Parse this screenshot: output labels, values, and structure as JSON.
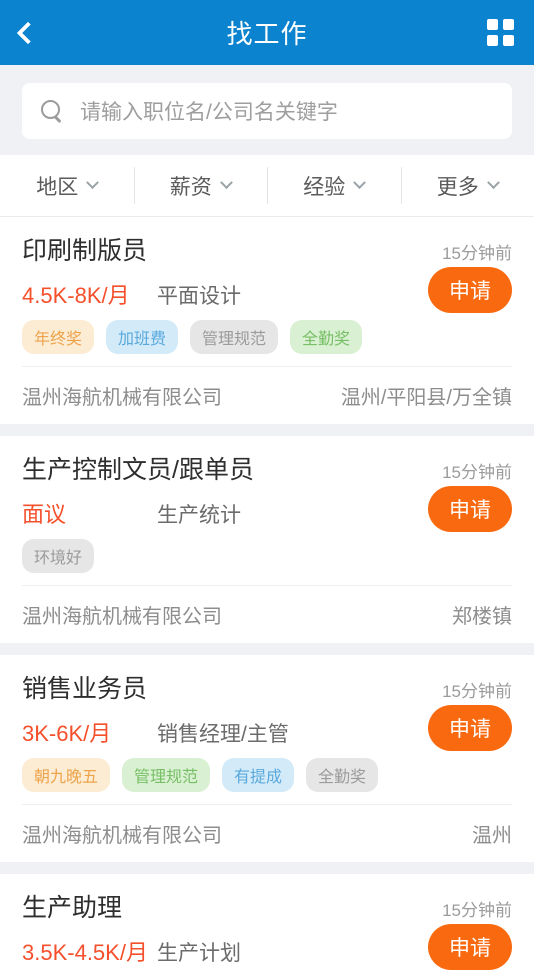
{
  "header": {
    "title": "找工作",
    "back_icon": "chevron-left-icon",
    "grid_icon": "grid-menu-icon",
    "bg_color": "#0b83cf"
  },
  "search": {
    "icon": "search-icon",
    "placeholder": "请输入职位名/公司名关键字",
    "value": ""
  },
  "filters": [
    {
      "label": "地区",
      "icon": "chevron-down-icon"
    },
    {
      "label": "薪资",
      "icon": "chevron-down-icon"
    },
    {
      "label": "经验",
      "icon": "chevron-down-icon"
    },
    {
      "label": "更多",
      "icon": "chevron-down-icon"
    }
  ],
  "apply_label": "申请",
  "colors": {
    "accent_blue": "#0b83cf",
    "apply_orange": "#f96a10",
    "salary_red": "#f5502c",
    "page_bg": "#f0f1f4"
  },
  "jobs": [
    {
      "title": "印刷制版员",
      "time": "15分钟前",
      "salary": "4.5K-8K/月",
      "category": "平面设计",
      "tags": [
        {
          "label": "年终奖",
          "color": "orange"
        },
        {
          "label": "加班费",
          "color": "blue"
        },
        {
          "label": "管理规范",
          "color": "gray"
        },
        {
          "label": "全勤奖",
          "color": "green"
        }
      ],
      "company": "温州海航机械有限公司",
      "location": "温州/平阳县/万全镇",
      "apply_label": "申请"
    },
    {
      "title": "生产控制文员/跟单员",
      "time": "15分钟前",
      "salary": "面议",
      "category": "生产统计",
      "tags": [
        {
          "label": "环境好",
          "color": "gray"
        }
      ],
      "company": "温州海航机械有限公司",
      "location": "郑楼镇",
      "apply_label": "申请"
    },
    {
      "title": "销售业务员",
      "time": "15分钟前",
      "salary": "3K-6K/月",
      "category": "销售经理/主管",
      "tags": [
        {
          "label": "朝九晚五",
          "color": "orange"
        },
        {
          "label": "管理规范",
          "color": "green"
        },
        {
          "label": "有提成",
          "color": "blue"
        },
        {
          "label": "全勤奖",
          "color": "gray"
        }
      ],
      "company": "温州海航机械有限公司",
      "location": "温州",
      "apply_label": "申请"
    },
    {
      "title": "生产助理",
      "time": "15分钟前",
      "salary": "3.5K-4.5K/月",
      "category": "生产计划",
      "tags": [],
      "company": "",
      "location": "",
      "apply_label": "申请"
    }
  ]
}
